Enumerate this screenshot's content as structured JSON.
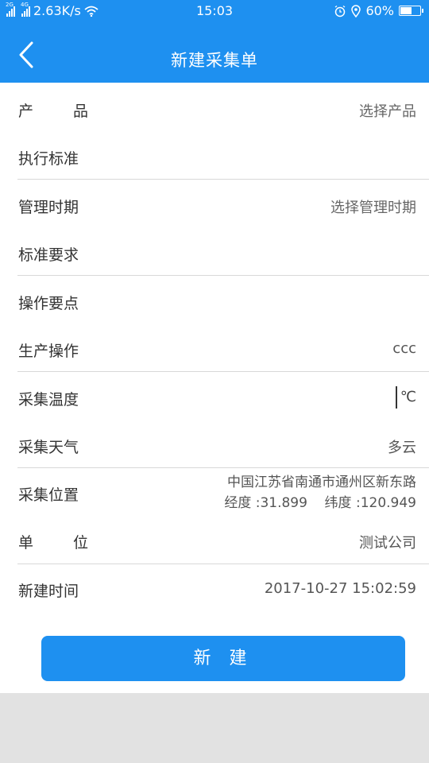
{
  "status_bar": {
    "network_1": "2G",
    "network_2": "4G",
    "speed": "2.63K/s",
    "time": "15:03",
    "battery": "60%",
    "battery_level": 0.6,
    "icons": [
      "signal-icon",
      "wifi-icon",
      "alarm-icon",
      "location-icon",
      "battery-icon"
    ]
  },
  "header": {
    "title": "新建采集单",
    "back_icon": "chevron-left-icon"
  },
  "form": {
    "product": {
      "label_a": "产",
      "label_b": "品",
      "value": "选择产品"
    },
    "standard": {
      "label": "执行标准"
    },
    "period": {
      "label": "管理时期",
      "value": "选择管理时期"
    },
    "requirement": {
      "label": "标准要求"
    },
    "key_points": {
      "label": "操作要点"
    },
    "production": {
      "label": "生产操作",
      "value": "ccc"
    },
    "temperature": {
      "label": "采集温度",
      "unit": "℃"
    },
    "weather": {
      "label": "采集天气",
      "value": "多云"
    },
    "location": {
      "label": "采集位置",
      "address": "中国江苏省南通市通州区新东路",
      "coords": "经度 :31.899    纬度 :120.949"
    },
    "unit": {
      "label_a": "单",
      "label_b": "位",
      "value": "测试公司"
    },
    "created_time": {
      "label": "新建时间",
      "value": "2017-10-27 15:02:59"
    }
  },
  "actions": {
    "create_label": "新 建"
  },
  "colors": {
    "primary": "#1e90f0",
    "background": "#ffffff",
    "footer": "#e2e2e2"
  }
}
